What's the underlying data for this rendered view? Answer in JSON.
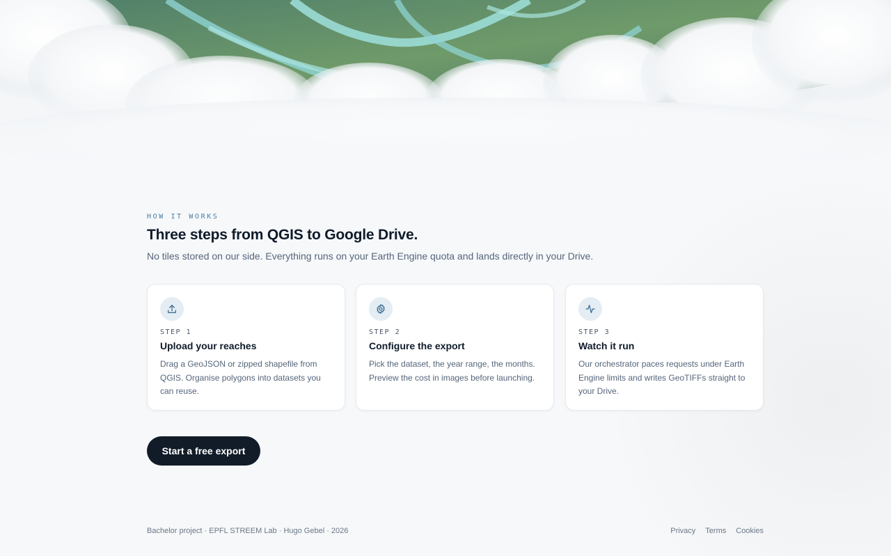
{
  "section": {
    "eyebrow": "HOW IT WORKS",
    "title": "Three steps from QGIS to Google Drive.",
    "subtitle": "No tiles stored on our side. Everything runs on your Earth Engine quota and lands directly in your Drive."
  },
  "steps": [
    {
      "icon": "upload-icon",
      "label": "STEP 1",
      "title": "Upload your reaches",
      "body": "Drag a GeoJSON or zipped shapefile from QGIS. Organise polygons into datasets you can reuse."
    },
    {
      "icon": "gear-icon",
      "label": "STEP 2",
      "title": "Configure the export",
      "body": "Pick the dataset, the year range, the months. Preview the cost in images before launching."
    },
    {
      "icon": "activity-icon",
      "label": "STEP 3",
      "title": "Watch it run",
      "body": "Our orchestrator paces requests under Earth Engine limits and writes GeoTIFFs straight to your Drive."
    }
  ],
  "cta": {
    "label": "Start a free export"
  },
  "footer": {
    "credit": "Bachelor project · EPFL STREEM Lab · Hugo Gebel · 2026",
    "links": [
      "Privacy",
      "Terms",
      "Cookies"
    ]
  },
  "colors": {
    "accent": "#4c7ea3",
    "dark": "#111c28",
    "icon_bg": "#e4edf4"
  }
}
